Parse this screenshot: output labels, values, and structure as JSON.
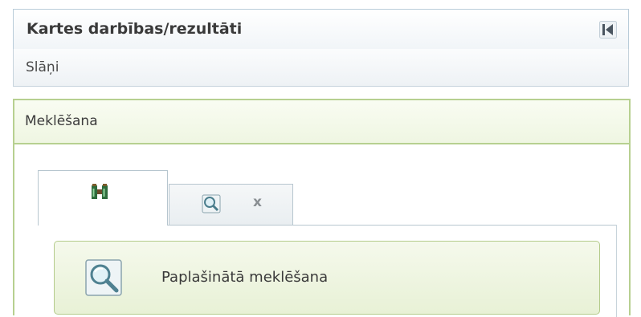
{
  "header": {
    "title": "Kartes darbības/rezultāti",
    "collapse_icon": "collapse-left-icon"
  },
  "layers_section": {
    "label": "Slāņi"
  },
  "search_section": {
    "label": "Meklēšana",
    "tabs": [
      {
        "icon": "binoculars-icon",
        "active": true
      },
      {
        "icon": "magnifier-icon",
        "active": false,
        "close_label": "x"
      }
    ],
    "advanced_search": {
      "label": "Paplašinātā meklēšana",
      "icon": "magnifier-icon"
    }
  },
  "colors": {
    "header_border": "#b9ccd9",
    "accent_green_border": "#b7d090",
    "green_bg": "#eff6e2"
  }
}
